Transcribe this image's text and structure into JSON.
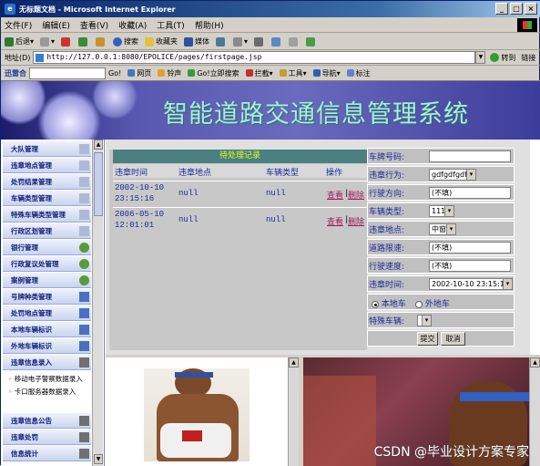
{
  "window": {
    "title": "无标题文档 - Microsoft Internet Explorer",
    "controls": [
      "_",
      "□",
      "×"
    ]
  },
  "menu": [
    "文件(F)",
    "编辑(E)",
    "查看(V)",
    "收藏(A)",
    "工具(T)",
    "帮助(H)"
  ],
  "toolbar": {
    "back": "后退",
    "search": "搜索",
    "favorites": "收藏夹",
    "media": "媒体"
  },
  "address": {
    "label": "地址(D)",
    "url": "http://127.0.0.1:8080/EPOLICE/pages/firstpage.jsp",
    "go": "转到",
    "links": "链接"
  },
  "linkbar": {
    "brand": "迅雷合",
    "go": "Go!",
    "items": [
      "网页",
      "铃声",
      "Go!立即搜索",
      "拦截",
      "工具",
      "导航",
      "标注"
    ]
  },
  "banner": {
    "title": "智能道路交通信息管理系统"
  },
  "nav": {
    "items": [
      "大队管理",
      "违章地点管理",
      "处罚结果管理",
      "车辆类型管理",
      "特殊车辆类型管理",
      "行政区划管理",
      "银行管理",
      "行政复议处管理",
      "案例管理",
      "号牌种类管理",
      "处罚地点管理",
      "本地车辆标识",
      "外地车辆标识",
      "违章信息录入"
    ],
    "subitems": [
      "◦ 移动电子警察数据录入",
      "◦ 卡口服务器数据录入"
    ],
    "bottom_items": [
      "违章信息公告",
      "违章处罚",
      "信息统计"
    ]
  },
  "pending": {
    "caption": "待处理记录",
    "headers": [
      "违章时间",
      "违章地点",
      "车辆类型",
      "操作"
    ],
    "rows": [
      {
        "time1": "2002-10-10",
        "time2": "23:15:16",
        "place": "null",
        "type": "null",
        "view": "查看",
        "sep": "|",
        "del": "删除"
      },
      {
        "time1": "2006-05-10",
        "time2": "12:01:01",
        "place": "null",
        "type": "null",
        "view": "查看",
        "sep": "|",
        "del": "删除"
      }
    ]
  },
  "form": {
    "plate_label": "车牌号码:",
    "plate_value": "",
    "behavior_label": "违章行为:",
    "behavior_value": "gdfgdfgdf",
    "direction_label": "行驶方向:",
    "direction_value": "(不填)",
    "vtype_label": "车辆类型:",
    "vtype_value": "111",
    "place_label": "违章地点:",
    "place_value": "中窗",
    "limit_label": "道路限速:",
    "limit_value": "(不填)",
    "speed_label": "行驶速度:",
    "speed_value": "(不填)",
    "time_label": "违章时间:",
    "time_value": "2002-10-10 23:15:16",
    "local_label": "本地车",
    "foreign_label": "外地车",
    "special_label": "特殊车辆:",
    "special_value": "",
    "submit": "提交",
    "cancel": "取消"
  },
  "watermark": "CSDN @毕业设计方案专家"
}
